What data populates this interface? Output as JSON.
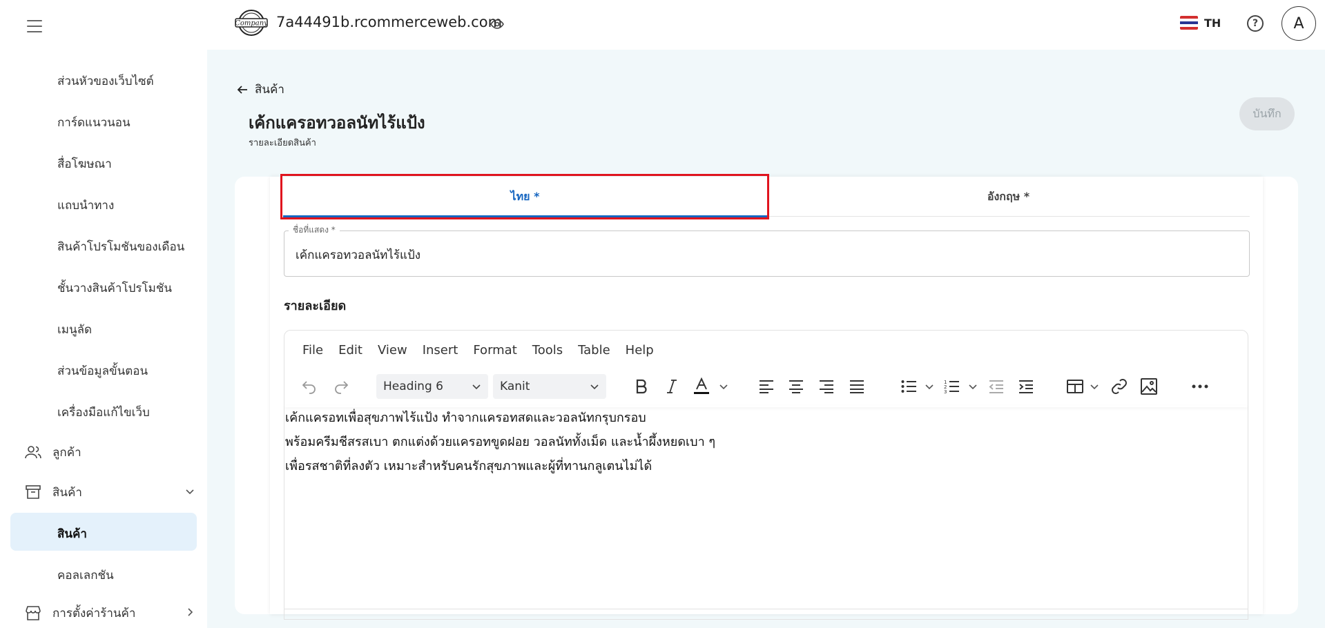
{
  "sidebar": {
    "sub_items_top": [
      "ส่วนหัวของเว็บไซต์",
      "การ์ดแนวนอน",
      "สื่อโฆษณา",
      "แถบนำทาง",
      "สินค้าโปรโมชันของเดือน",
      "ชั้นวางสินค้าโปรโมชัน",
      "เมนูลัด",
      "ส่วนข้อมูลขั้นตอน",
      "เครื่องมือแก้ไขเว็บ"
    ],
    "customers_label": "ลูกค้า",
    "products_label": "สินค้า",
    "products_sub_active": "สินค้า",
    "collections_label": "คอลเลกชัน",
    "store_settings_label": "การตั้งค่าร้านค้า"
  },
  "topbar": {
    "site_name": "7a44491b.rcommerceweb.com",
    "lang_code": "TH",
    "help_glyph": "?",
    "avatar_letter": "A",
    "logo_text": "Company"
  },
  "header": {
    "back_label": "สินค้า",
    "title": "เค้กแครอทวอลนัทไร้แป้ง",
    "subtitle": "รายละเอียดสินค้า",
    "save_label": "บันทึก"
  },
  "tabs": {
    "thai": "ไทย *",
    "english": "อังกฤษ *"
  },
  "name_field": {
    "label": "ชื่อที่แสดง *",
    "value": "เค้กแครอทวอลนัทไร้แป้ง"
  },
  "details": {
    "title": "รายละเอียด"
  },
  "editor": {
    "menu": [
      "File",
      "Edit",
      "View",
      "Insert",
      "Format",
      "Tools",
      "Table",
      "Help"
    ],
    "block_format": "Heading 6",
    "font_family": "Kanit",
    "content": [
      "เค้กแครอทเพื่อสุขภาพไร้แป้ง ทำจากแครอทสดและวอลนัทกรุบกรอบ",
      "พร้อมครีมชีสรสเบา ตกแต่งด้วยแครอทขูดฝอย วอลนัททั้งเม็ด และน้ำผึ้งหยดเบา ๆ",
      "เพื่อรสชาติที่ลงตัว เหมาะสำหรับคนรักสุขภาพและผู้ที่ทานกลูเตนไม่ได้"
    ]
  },
  "colors": {
    "accent": "#1565c0",
    "highlight": "#e0141e",
    "active_bg": "#e4f1fb",
    "page_bg": "#f1f8fa"
  }
}
